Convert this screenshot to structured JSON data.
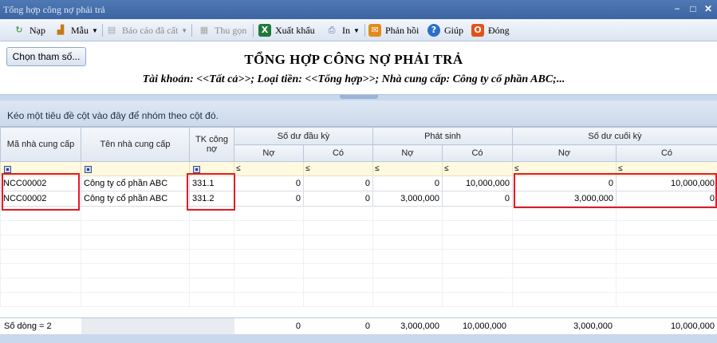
{
  "window": {
    "title": "Tổng hợp công nợ phải trả"
  },
  "toolbar": {
    "items": [
      {
        "label": "Nạp",
        "icon": "refresh-icon"
      },
      {
        "label": "Mẫu",
        "icon": "chart-icon"
      },
      {
        "label": "Báo cáo đã cất",
        "icon": "saved-report-icon"
      },
      {
        "label": "Thu gọn",
        "icon": "collapse-icon"
      },
      {
        "label": "Xuất khẩu",
        "icon": "excel-icon"
      },
      {
        "label": "In",
        "icon": "print-icon"
      },
      {
        "label": "Phản hồi",
        "icon": "mail-icon"
      },
      {
        "label": "Giúp",
        "icon": "help-icon"
      },
      {
        "label": "Đóng",
        "icon": "close-icon"
      }
    ]
  },
  "report": {
    "param_button": "Chọn tham số...",
    "title": "TỔNG HỢP CÔNG NỢ PHẢI TRẢ",
    "subtitle": "Tài khoản: <<Tất cả>>; Loại tiền: <<Tổng hợp>>; Nhà cung cấp: Công ty cổ phần ABC;..."
  },
  "grid": {
    "group_hint": "Kéo một tiêu đề cột vào đây để nhóm theo cột đó.",
    "headers": {
      "supplier_code": "Mã nhà cung cấp",
      "supplier_name": "Tên nhà cung cấp",
      "account": "TK công nợ",
      "opening": "Số dư đầu kỳ",
      "movement": "Phát sinh",
      "closing": "Số dư cuối kỳ",
      "debit": "Nợ",
      "credit": "Có"
    },
    "filter_op": "≤",
    "rows": [
      {
        "code": "NCC00002",
        "name": "Công ty cổ phần ABC",
        "account": "331.1",
        "open_debit": "0",
        "open_credit": "0",
        "mov_debit": "0",
        "mov_credit": "10,000,000",
        "close_debit": "0",
        "close_credit": "10,000,000"
      },
      {
        "code": "NCC00002",
        "name": "Công ty cổ phần ABC",
        "account": "331.2",
        "open_debit": "0",
        "open_credit": "0",
        "mov_debit": "3,000,000",
        "mov_credit": "0",
        "close_debit": "3,000,000",
        "close_credit": "0"
      }
    ],
    "footer": {
      "row_count": "Số dòng = 2",
      "open_debit": "0",
      "open_credit": "0",
      "mov_debit": "3,000,000",
      "mov_credit": "10,000,000",
      "close_debit": "3,000,000",
      "close_credit": "10,000,000"
    }
  },
  "colors": {
    "title_bar": "#3c65a3",
    "highlight": "#e31b23",
    "filter_row": "#fffadf"
  }
}
